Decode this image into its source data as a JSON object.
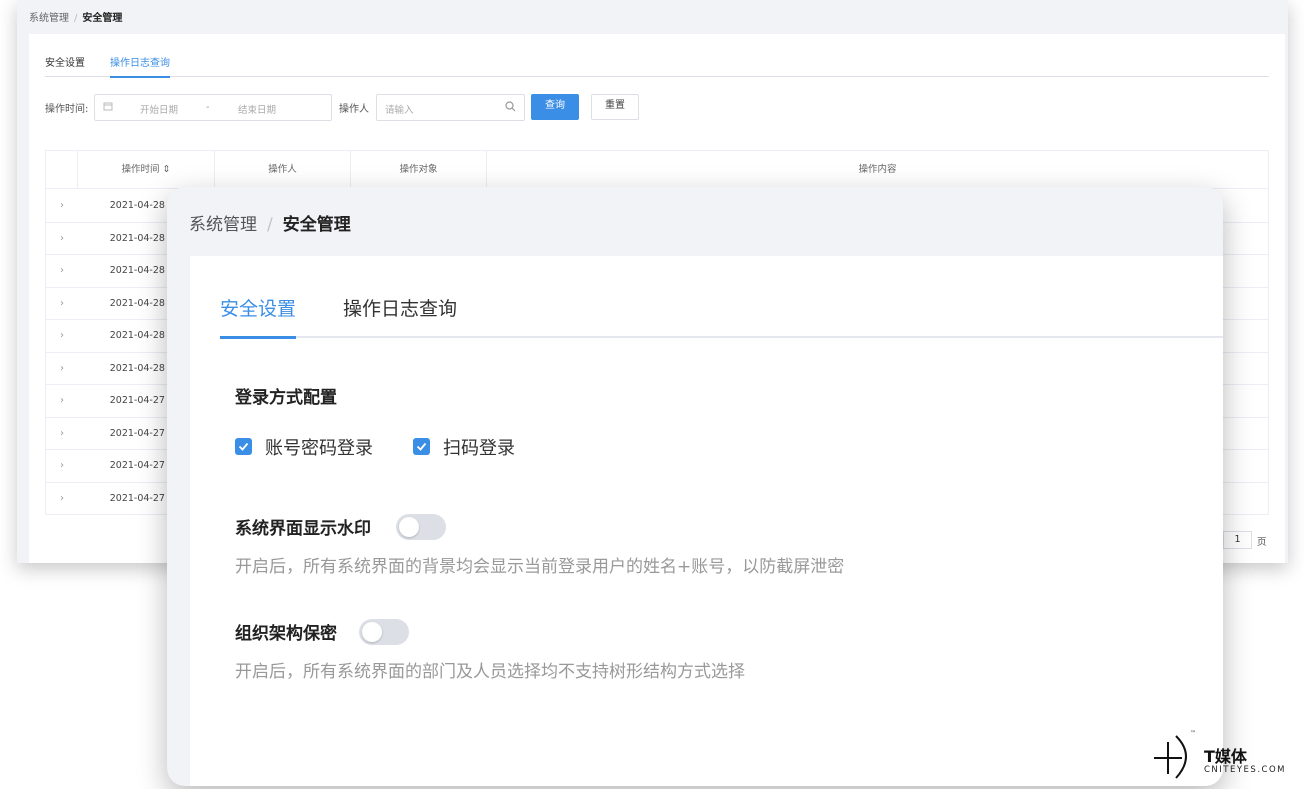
{
  "bg_window": {
    "breadcrumb": {
      "parent": "系统管理",
      "separator": "/",
      "current": "安全管理"
    },
    "tabs": [
      {
        "label": "安全设置"
      },
      {
        "label": "操作日志查询"
      }
    ],
    "filter": {
      "time_label": "操作时间:",
      "start_placeholder": "开始日期",
      "range_separator": "-",
      "end_placeholder": "结束日期",
      "operator_label": "操作人",
      "operator_placeholder": "请输入",
      "search_button": "查询",
      "reset_button": "重置"
    },
    "table": {
      "columns": [
        {
          "label": "操作时间 ⇕"
        },
        {
          "label": "操作人"
        },
        {
          "label": "操作对象"
        },
        {
          "label": "操作内容"
        }
      ],
      "rows": [
        {
          "time": "2021-04-28 18:"
        },
        {
          "time": "2021-04-28 18:"
        },
        {
          "time": "2021-04-28 17:"
        },
        {
          "time": "2021-04-28 15:"
        },
        {
          "time": "2021-04-28 13:"
        },
        {
          "time": "2021-04-28 13:"
        },
        {
          "time": "2021-04-27 16:"
        },
        {
          "time": "2021-04-27 16:"
        },
        {
          "time": "2021-04-27 15:"
        },
        {
          "time": "2021-04-27 15:"
        }
      ]
    },
    "pager": {
      "page": "1",
      "suffix": "页"
    }
  },
  "fg_card": {
    "breadcrumb": {
      "parent": "系统管理",
      "separator": "/",
      "current": "安全管理"
    },
    "tabs": [
      {
        "label": "安全设置",
        "active": true
      },
      {
        "label": "操作日志查询",
        "active": false
      }
    ],
    "login_config": {
      "title": "登录方式配置",
      "options": [
        {
          "label": "账号密码登录",
          "checked": true
        },
        {
          "label": "扫码登录",
          "checked": true
        }
      ]
    },
    "watermark_setting": {
      "title": "系统界面显示水印",
      "enabled": false,
      "description": "开启后，所有系统界面的背景均会显示当前登录用户的姓名+账号，以防截屏泄密"
    },
    "org_secret_setting": {
      "title": "组织架构保密",
      "enabled": false,
      "description": "开启后，所有系统界面的部门及人员选择均不支持树形结构方式选择"
    }
  },
  "watermark": {
    "brand": "T媒体",
    "site": "CNITEYES.COM",
    "tm": "™"
  },
  "colors": {
    "accent": "#3a8ee6",
    "page_bg": "#f2f3f7",
    "toggle_off": "#dcdfe6"
  }
}
